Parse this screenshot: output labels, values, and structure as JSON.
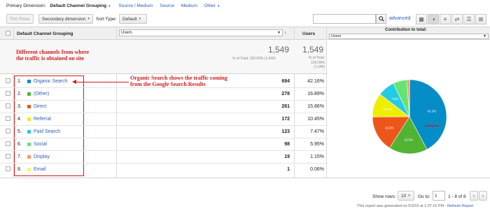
{
  "toolbar": {
    "primary_dimension_label": "Primary Dimension:",
    "primary_dimension_value": "Default Channel Grouping",
    "dim_links": [
      "Source / Medium",
      "Source",
      "Medium",
      "Other"
    ],
    "plot_rows": "Plot Rows",
    "secondary_dimension": "Secondary dimension",
    "sort_type_label": "Sort Type:",
    "sort_type_value": "Default",
    "search_placeholder": "",
    "advanced": "advanced"
  },
  "table": {
    "col_dimension": "Default Channel Grouping",
    "users_select": "Users",
    "col_users": "Users",
    "col_contribution": "Contribution to total:",
    "contribution_select": "Users",
    "total_big": "1,549",
    "total_sub": "% of Total: 100.00% (1,549)",
    "total_big2": "1,549",
    "total_sub2": "% of Total: 100.00% (1,549)",
    "rows": [
      {
        "num": "1.",
        "name": "Organic Search",
        "users": "694",
        "pct": "42.16%",
        "color": "#058dc7"
      },
      {
        "num": "2.",
        "name": "(Other)",
        "users": "278",
        "pct": "16.89%",
        "color": "#50b432"
      },
      {
        "num": "3.",
        "name": "Direct",
        "users": "261",
        "pct": "15.86%",
        "color": "#ed561b"
      },
      {
        "num": "4.",
        "name": "Referral",
        "users": "172",
        "pct": "10.45%",
        "color": "#edef00"
      },
      {
        "num": "5.",
        "name": "Paid Search",
        "users": "123",
        "pct": "7.47%",
        "color": "#24cbe5"
      },
      {
        "num": "6.",
        "name": "Social",
        "users": "98",
        "pct": "5.95%",
        "color": "#64e572"
      },
      {
        "num": "7.",
        "name": "Display",
        "users": "19",
        "pct": "1.15%",
        "color": "#ff9655"
      },
      {
        "num": "8.",
        "name": "Email",
        "users": "1",
        "pct": "0.06%",
        "color": "#fff263"
      }
    ]
  },
  "pie": {
    "values": [
      42.16,
      16.89,
      15.86,
      10.45,
      7.47,
      5.95,
      1.15,
      0.06
    ],
    "labels": [
      "42.2%",
      "16.9%",
      "15.9%",
      "10.4%",
      "7.5%",
      "",
      "",
      ""
    ]
  },
  "annotations": {
    "left_note": "Different channels from where the traffic is obtained on site",
    "organic_note_line1": "Organic Search shows the traffic coming",
    "organic_note_line2": "from the Google Search Results"
  },
  "footer": {
    "show_rows_label": "Show rows:",
    "show_rows_value": "10",
    "goto_label": "Go to:",
    "goto_value": "1",
    "range": "1 - 8 of 8",
    "generated": "This report was generated on 5/3/19 at 1:07:10 PM -",
    "refresh": "Refresh Report"
  }
}
